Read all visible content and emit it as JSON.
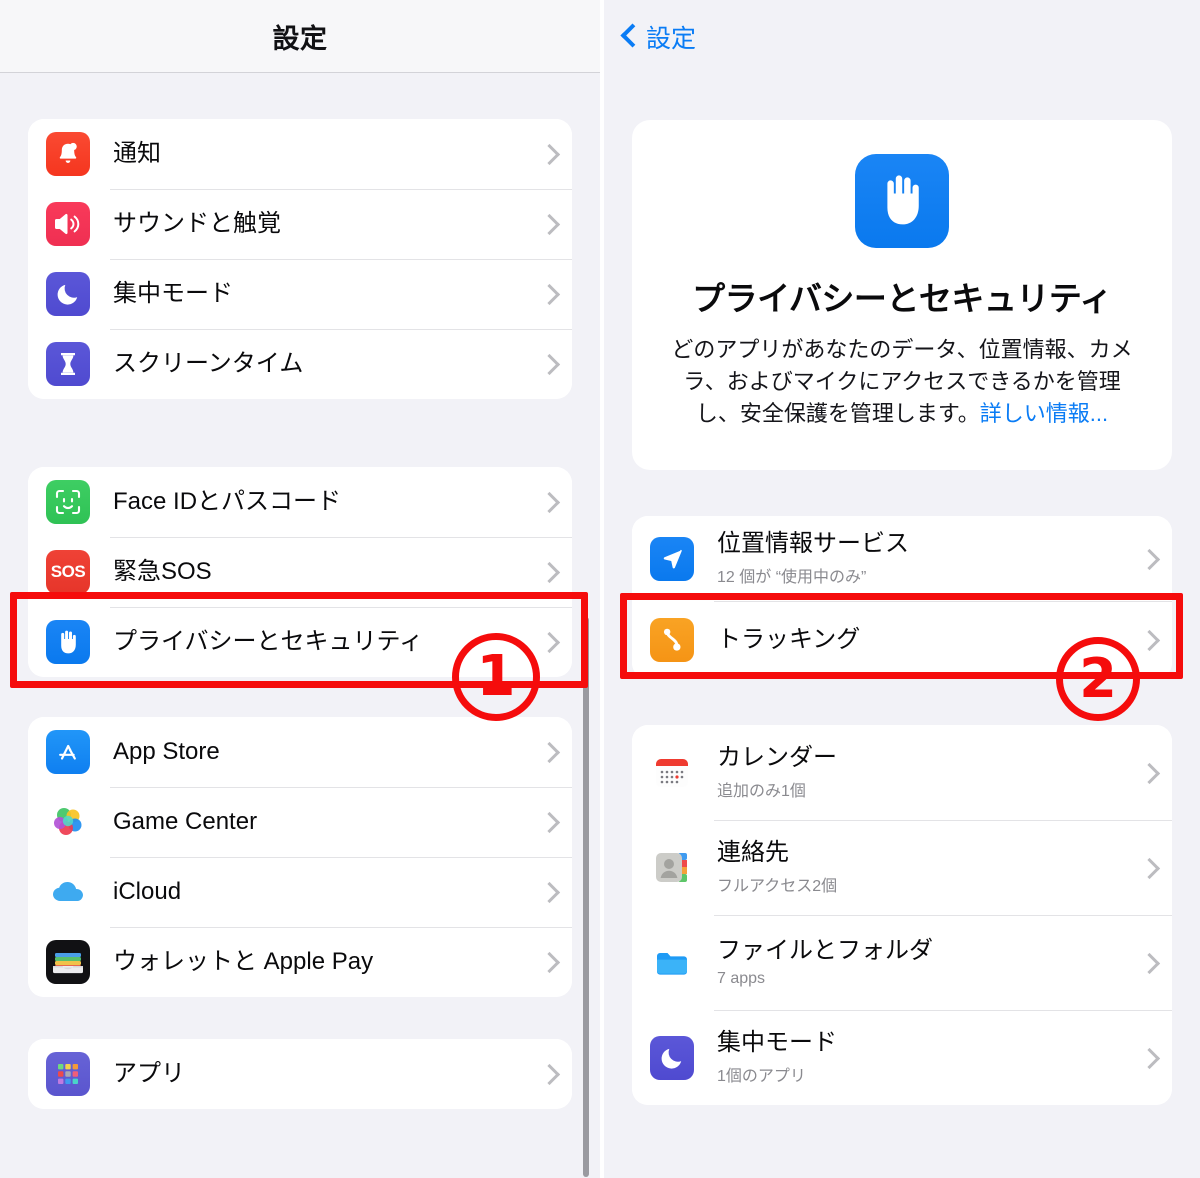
{
  "left": {
    "header_title": "設定",
    "groups": [
      {
        "rows": [
          {
            "icon": "bell-icon",
            "title": "通知"
          },
          {
            "icon": "speaker-icon",
            "title": "サウンドと触覚"
          },
          {
            "icon": "moon-icon",
            "title": "集中モード"
          },
          {
            "icon": "hourglass-icon",
            "title": "スクリーンタイム"
          }
        ]
      },
      {
        "rows": [
          {
            "icon": "faceid-icon",
            "title": "Face IDとパスコード"
          },
          {
            "icon": "sos-icon",
            "title": "緊急SOS"
          },
          {
            "icon": "hand-icon",
            "title": "プライバシーとセキュリティ"
          }
        ]
      },
      {
        "rows": [
          {
            "icon": "appstore-icon",
            "title": "App Store"
          },
          {
            "icon": "gamecenter-icon",
            "title": "Game Center"
          },
          {
            "icon": "icloud-icon",
            "title": "iCloud"
          },
          {
            "icon": "wallet-icon",
            "title": "ウォレットと Apple Pay"
          }
        ]
      },
      {
        "rows": [
          {
            "icon": "apps-grid-icon",
            "title": "アプリ"
          }
        ]
      }
    ]
  },
  "right": {
    "back_label": "設定",
    "hero": {
      "icon": "hand-icon",
      "title": "プライバシーとセキュリティ",
      "desc_text": "どのアプリがあなたのデータ、位置情報、カメラ、およびマイクにアクセスできるかを管理し、安全保護を管理します。",
      "desc_link": "詳しい情報..."
    },
    "groups": [
      {
        "rows": [
          {
            "icon": "location-arrow-icon",
            "title": "位置情報サービス",
            "sub": "12 個が “使用中のみ”"
          },
          {
            "icon": "tracking-icon",
            "title": "トラッキング",
            "sub": ""
          }
        ]
      },
      {
        "rows": [
          {
            "icon": "calendar-icon",
            "title": "カレンダー",
            "sub": "追加のみ1個"
          },
          {
            "icon": "contacts-icon",
            "title": "連絡先",
            "sub": "フルアクセス2個"
          },
          {
            "icon": "folder-icon",
            "title": "ファイルとフォルダ",
            "sub": "7 apps"
          },
          {
            "icon": "moon-icon",
            "title": "集中モード",
            "sub": "1個のアプリ"
          }
        ]
      }
    ]
  },
  "annotations": {
    "step1_label": "1",
    "step2_label": "2",
    "color": "#f50c0c"
  }
}
